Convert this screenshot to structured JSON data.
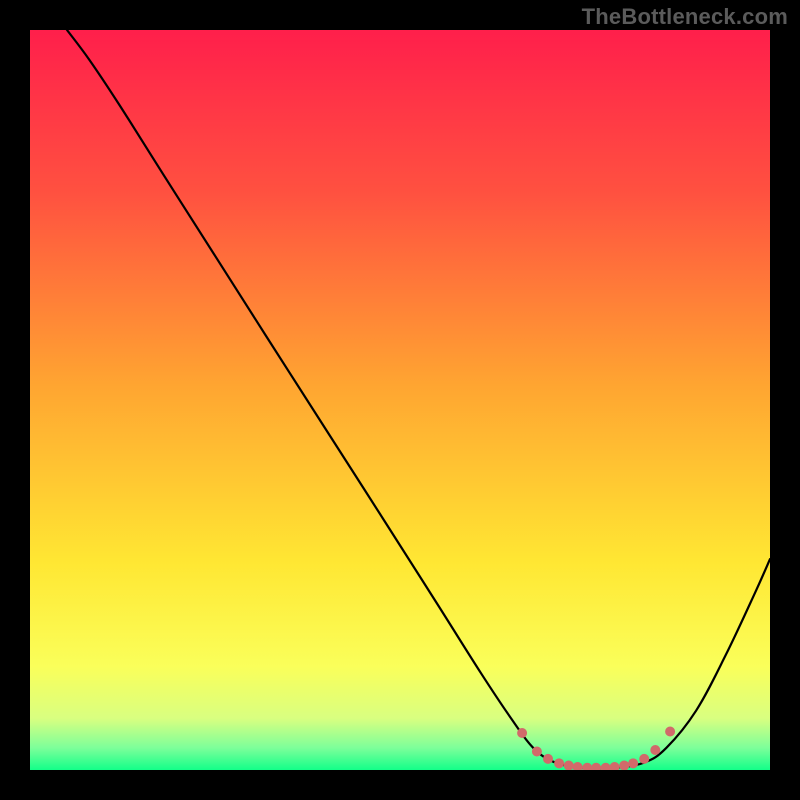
{
  "watermark": "TheBottleneck.com",
  "chart_data": {
    "type": "line",
    "title": "",
    "xlabel": "",
    "ylabel": "",
    "xlim": [
      0,
      100
    ],
    "ylim": [
      0,
      100
    ],
    "gradient_stops": [
      {
        "offset": 0,
        "color": "#ff1f4b"
      },
      {
        "offset": 22,
        "color": "#ff5140"
      },
      {
        "offset": 48,
        "color": "#ffa531"
      },
      {
        "offset": 72,
        "color": "#ffe733"
      },
      {
        "offset": 86,
        "color": "#faff5a"
      },
      {
        "offset": 93,
        "color": "#d9ff80"
      },
      {
        "offset": 97,
        "color": "#7dff9a"
      },
      {
        "offset": 100,
        "color": "#13ff89"
      }
    ],
    "series": [
      {
        "name": "bottleneck-curve",
        "color": "#000000",
        "width": 2.2,
        "points": [
          {
            "x": 5,
            "y": 100.0
          },
          {
            "x": 8,
            "y": 96.0
          },
          {
            "x": 12,
            "y": 90.0
          },
          {
            "x": 18,
            "y": 80.5
          },
          {
            "x": 25,
            "y": 69.5
          },
          {
            "x": 32,
            "y": 58.5
          },
          {
            "x": 40,
            "y": 46.0
          },
          {
            "x": 48,
            "y": 33.5
          },
          {
            "x": 55,
            "y": 22.5
          },
          {
            "x": 61,
            "y": 13.0
          },
          {
            "x": 65,
            "y": 7.0
          },
          {
            "x": 68,
            "y": 3.0
          },
          {
            "x": 71,
            "y": 1.0
          },
          {
            "x": 75,
            "y": 0.3
          },
          {
            "x": 79,
            "y": 0.3
          },
          {
            "x": 83,
            "y": 1.0
          },
          {
            "x": 86,
            "y": 3.0
          },
          {
            "x": 90,
            "y": 8.0
          },
          {
            "x": 94,
            "y": 15.5
          },
          {
            "x": 98,
            "y": 24.0
          },
          {
            "x": 100,
            "y": 28.5
          }
        ]
      }
    ],
    "markers": {
      "name": "optimum-dots",
      "color": "#d16a6a",
      "radius": 5,
      "points": [
        {
          "x": 66.5,
          "y": 5.0
        },
        {
          "x": 68.5,
          "y": 2.5
        },
        {
          "x": 70.0,
          "y": 1.5
        },
        {
          "x": 71.5,
          "y": 0.9
        },
        {
          "x": 72.8,
          "y": 0.6
        },
        {
          "x": 74.0,
          "y": 0.4
        },
        {
          "x": 75.3,
          "y": 0.3
        },
        {
          "x": 76.5,
          "y": 0.3
        },
        {
          "x": 77.8,
          "y": 0.3
        },
        {
          "x": 79.0,
          "y": 0.4
        },
        {
          "x": 80.3,
          "y": 0.6
        },
        {
          "x": 81.5,
          "y": 0.9
        },
        {
          "x": 83.0,
          "y": 1.5
        },
        {
          "x": 84.5,
          "y": 2.7
        },
        {
          "x": 86.5,
          "y": 5.2
        }
      ]
    }
  }
}
